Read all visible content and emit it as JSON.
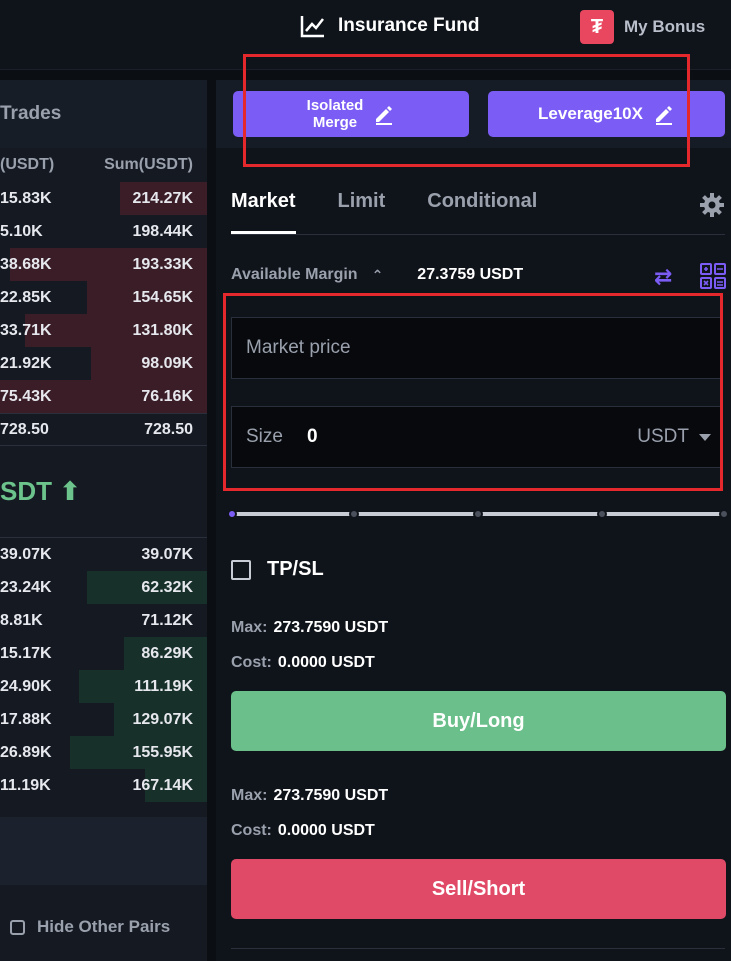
{
  "topbar": {
    "insurance_label": "Insurance Fund",
    "bonus_label": "My Bonus",
    "bonus_icon_glyph": "₮"
  },
  "orderbook": {
    "title": "Trades",
    "col_amount": "(USDT)",
    "col_sum": "Sum(USDT)",
    "asks": [
      {
        "amount": "15.83K",
        "sum": "214.27K",
        "depth": 0.42
      },
      {
        "amount": "5.10K",
        "sum": "198.44K",
        "depth": 0.0
      },
      {
        "amount": "38.68K",
        "sum": "193.33K",
        "depth": 0.95
      },
      {
        "amount": "22.85K",
        "sum": "154.65K",
        "depth": 0.58
      },
      {
        "amount": "33.71K",
        "sum": "131.80K",
        "depth": 0.88
      },
      {
        "amount": "21.92K",
        "sum": "98.09K",
        "depth": 0.56
      },
      {
        "amount": "75.43K",
        "sum": "76.16K",
        "depth": 1.0
      },
      {
        "amount": "728.50",
        "sum": "728.50",
        "depth": 0.0
      }
    ],
    "last_price": "SDT ⬆",
    "bids": [
      {
        "amount": "39.07K",
        "sum": "39.07K",
        "depth": 0.0
      },
      {
        "amount": "23.24K",
        "sum": "62.32K",
        "depth": 0.58
      },
      {
        "amount": "8.81K",
        "sum": "71.12K",
        "depth": 0.0
      },
      {
        "amount": "15.17K",
        "sum": "86.29K",
        "depth": 0.4
      },
      {
        "amount": "24.90K",
        "sum": "111.19K",
        "depth": 0.62
      },
      {
        "amount": "17.88K",
        "sum": "129.07K",
        "depth": 0.45
      },
      {
        "amount": "26.89K",
        "sum": "155.95K",
        "depth": 0.66
      },
      {
        "amount": "11.19K",
        "sum": "167.14K",
        "depth": 0.3
      }
    ],
    "hide_pairs_label": "Hide Other Pairs"
  },
  "mode": {
    "isolated_line1": "Isolated",
    "isolated_line2": "Merge",
    "leverage_label": "Leverage10X"
  },
  "tabs": [
    "Market",
    "Limit",
    "Conditional"
  ],
  "available": {
    "label": "Available Margin",
    "value": "27.3759 USDT"
  },
  "price_field": {
    "placeholder": "Market price"
  },
  "size_field": {
    "label": "Size",
    "value": "0",
    "unit": "USDT"
  },
  "tpsl_label": "TP/SL",
  "buy": {
    "max_label": "Max:",
    "max_value": "273.7590 USDT",
    "cost_label": "Cost:",
    "cost_value": "0.0000 USDT",
    "button": "Buy/Long"
  },
  "sell": {
    "max_label": "Max:",
    "max_value": "273.7590 USDT",
    "cost_label": "Cost:",
    "cost_value": "0.0000 USDT",
    "button": "Sell/Short"
  },
  "colors": {
    "accent": "#7b5cf5",
    "buy": "#6abf8a",
    "sell": "#e04a67",
    "highlight": "#e5282b"
  }
}
